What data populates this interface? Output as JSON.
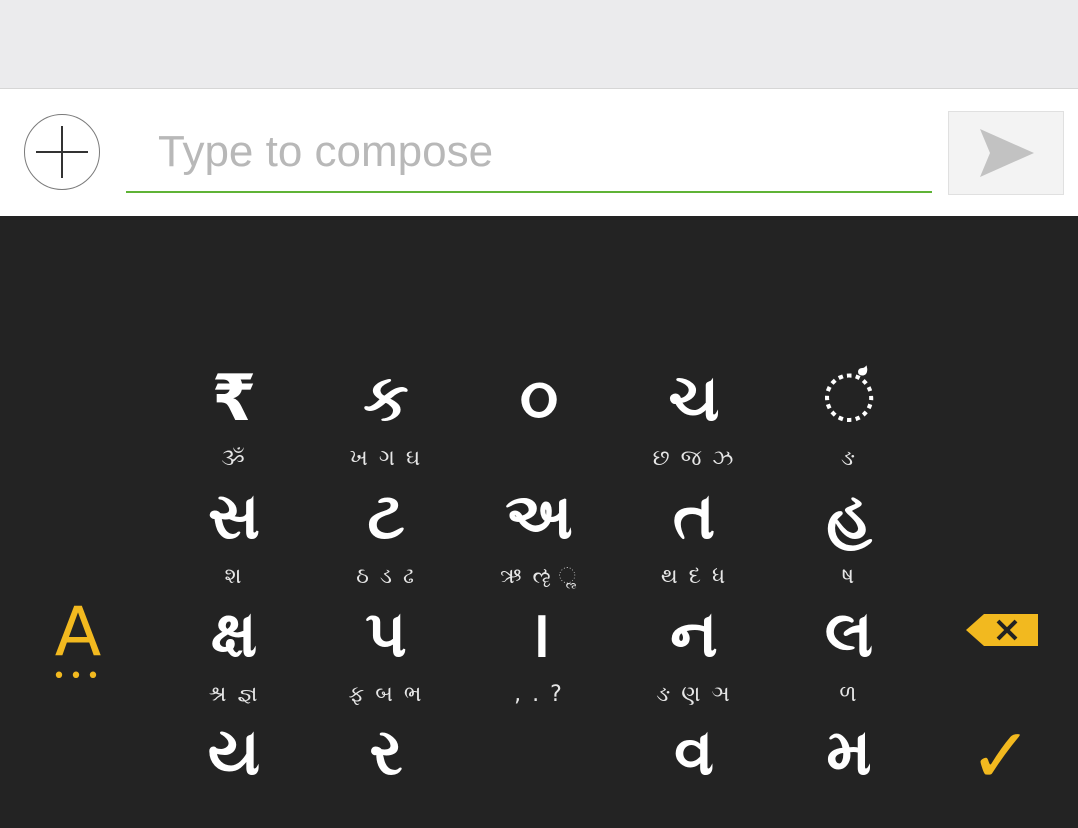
{
  "compose": {
    "placeholder": "Type to compose",
    "accent_color": "#5fb336"
  },
  "keyboard": {
    "mode_label": "A",
    "mode_dots": "•••",
    "done_symbol": "✓",
    "accent_color": "#f2b91f",
    "rows": [
      [
        {
          "main": "₹",
          "sub": "ૐ"
        },
        {
          "main": "ક",
          "sub": "ખ ગ ઘ"
        },
        {
          "main": "૦",
          "sub": ""
        },
        {
          "main": "ચ",
          "sub": "છ જ ઝ"
        },
        {
          "main": "ં",
          "sub": "ઙ"
        }
      ],
      [
        {
          "main": "સ",
          "sub": "શ"
        },
        {
          "main": "ટ",
          "sub": "ઠ ડ ઢ"
        },
        {
          "main": "અ",
          "sub": "ઋ ૡ ૢ"
        },
        {
          "main": "ત",
          "sub": "થ દ ધ"
        },
        {
          "main": "હ",
          "sub": "ષ"
        }
      ],
      [
        {
          "main": "ક્ષ",
          "sub": "શ્ર જ્ઞ"
        },
        {
          "main": "પ",
          "sub": "ફ બ ભ"
        },
        {
          "main": "।",
          "sub": ", . ?"
        },
        {
          "main": "ન",
          "sub": "ઙ ણ ઞ"
        },
        {
          "main": "લ",
          "sub": "ળ"
        }
      ],
      [
        {
          "main": "ય",
          "sub": ""
        },
        {
          "main": "ર",
          "sub": ""
        },
        {
          "main": "",
          "sub": ""
        },
        {
          "main": "વ",
          "sub": ""
        },
        {
          "main": "મ",
          "sub": ""
        }
      ]
    ]
  }
}
